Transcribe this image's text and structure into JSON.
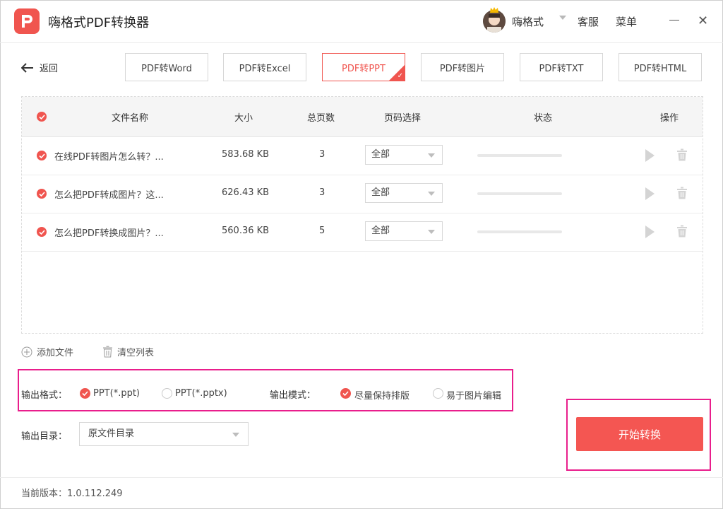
{
  "app": {
    "title": "嗨格式PDF转换器"
  },
  "header": {
    "user_name": "嗨格式",
    "service": "客服",
    "menu": "菜单",
    "close_glyph": "✕"
  },
  "nav": {
    "back_label": "返回",
    "tabs": [
      {
        "label": "PDF转Word",
        "active": false
      },
      {
        "label": "PDF转Excel",
        "active": false
      },
      {
        "label": "PDF转PPT",
        "active": true
      },
      {
        "label": "PDF转图片",
        "active": false
      },
      {
        "label": "PDF转TXT",
        "active": false
      },
      {
        "label": "PDF转HTML",
        "active": false
      }
    ]
  },
  "table": {
    "headers": {
      "name": "文件名称",
      "size": "大小",
      "pages": "总页数",
      "page_select": "页码选择",
      "status": "状态",
      "actions": "操作"
    },
    "rows": [
      {
        "name": "在线PDF转图片怎么转？...",
        "size": "583.68 KB",
        "pages": "3",
        "page_select": "全部"
      },
      {
        "name": "怎么把PDF转成图片？这...",
        "size": "626.43 KB",
        "pages": "3",
        "page_select": "全部"
      },
      {
        "name": "怎么把PDF转换成图片？...",
        "size": "560.36 KB",
        "pages": "5",
        "page_select": "全部"
      }
    ]
  },
  "actions": {
    "add_file": "添加文件",
    "clear_list": "清空列表"
  },
  "options": {
    "format_label": "输出格式：",
    "format_ppt": "PPT(*.ppt)",
    "format_pptx": "PPT(*.pptx)",
    "mode_label": "输出模式：",
    "mode_keep_layout": "尽量保持排版",
    "mode_easy_edit": "易于图片编辑",
    "outdir_label": "输出目录：",
    "outdir_value": "原文件目录"
  },
  "start_button": "开始转换",
  "footer": {
    "version": "当前版本：1.0.112.249"
  },
  "colors": {
    "accent": "#f0554f",
    "highlight": "#e91e8c"
  }
}
